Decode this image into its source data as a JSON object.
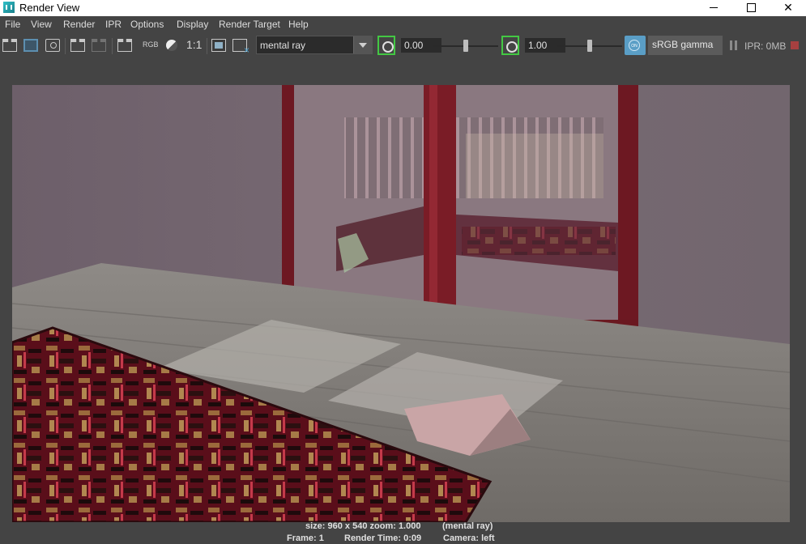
{
  "window": {
    "title": "Render View"
  },
  "menubar": [
    "File",
    "View",
    "Render",
    "IPR",
    "Options",
    "Display",
    "Render Target",
    "Help"
  ],
  "toolbar": {
    "rgb_label": "RGB",
    "ratio_label": "1:1",
    "renderer": "mental ray",
    "exposure_value": "0.00",
    "gamma_value": "1.00",
    "exposure_slider_fraction": 0.5,
    "gamma_slider_fraction": 0.5,
    "color_mgmt_badge": "ON",
    "color_space": "sRGB gamma",
    "ipr_status": "IPR: 0MB"
  },
  "status": {
    "size_info": "size: 960 x 540 zoom: 1.000",
    "renderer_info": "(mental ray)",
    "frame": "Frame: 1",
    "render_time": "Render Time: 0:09",
    "camera": "Camera: left"
  },
  "icons": [
    "render-clapper-icon",
    "redo-render-icon",
    "snapshot-camera-icon",
    "ipr-render-icon",
    "refresh-ipr-icon",
    "render-region-icon",
    "rgb-channel-icon",
    "alpha-sphere-icon",
    "real-size-icon",
    "keep-image-icon",
    "remove-image-icon",
    "exposure-icon",
    "gamma-icon",
    "color-management-icon",
    "pause-ipr-icon",
    "stop-render-icon"
  ]
}
